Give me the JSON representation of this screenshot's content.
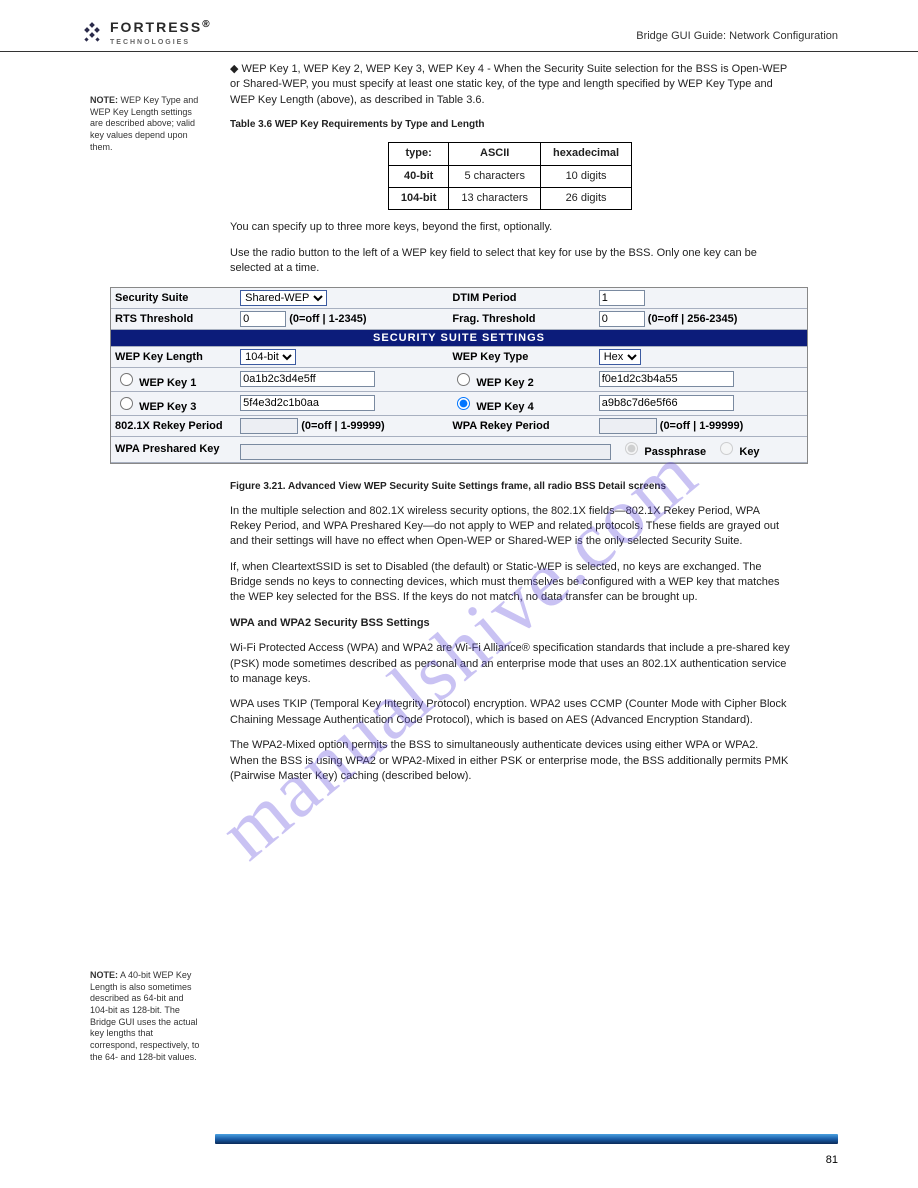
{
  "logo": {
    "main": "FORTRESS",
    "sub": "TECHNOLOGIES",
    "reg": "®"
  },
  "hdr_right": "Bridge GUI Guide: Network Configuration",
  "note1": {
    "title": "NOTE:",
    "body": "WEP Key Type and WEP Key Length settings are described above; valid key values depend upon them."
  },
  "note2": {
    "title": "NOTE:",
    "body": "A 40-bit WEP Key Length is also sometimes described as 64-bit and 104-bit as 128-bit. The Bridge GUI uses the actual key lengths that correspond, respectively, to the 64- and 128-bit values."
  },
  "para": {
    "p1_bullet": "◆  WEP Key 1, WEP Key 2, WEP Key 3, WEP Key 4 - When the Security Suite selection for the BSS is Open-WEP or Shared-WEP, you must specify at least one static key, of the type and length specified by WEP Key Type and WEP Key Length (above), as described in Table 3.6.",
    "tbl_caption": "Table 3.6 WEP Key Requirements by Type and Length",
    "p2": "You can specify up to three more keys, beyond the first, optionally.",
    "p3": "Use the radio button to the left of a WEP key field to select that key for use by the BSS. Only one key can be selected at a time.",
    "fig_caption": "Figure 3.21. Advanced View WEP Security Suite Settings frame, all radio BSS Detail screens",
    "p4": "In the multiple selection and 802.1X wireless security options, the 802.1X fields—802.1X Rekey Period, WPA Rekey Period, and WPA Preshared Key—do not apply to WEP and related protocols. These fields are grayed out and their settings will have no effect when Open-WEP or Shared-WEP is the only selected Security Suite.",
    "p5": "If, when CleartextSSID is set to Disabled (the default) or Static-WEP is selected, no keys are exchanged. The Bridge sends no keys to connecting devices, which must themselves be configured with a WEP key that matches the WEP key selected for the BSS. If the keys do not match, no data transfer can be brought up.",
    "heading": "WPA and WPA2 Security BSS Settings",
    "p6": "Wi-Fi Protected Access (WPA) and WPA2 are Wi-Fi Alliance® specification standards that include a pre-shared key (PSK) mode sometimes described as personal and an enterprise mode that uses an 802.1X authentication service to manage keys.",
    "p7": "WPA uses TKIP (Temporal Key Integrity Protocol) encryption. WPA2 uses CCMP (Counter Mode with Cipher Block Chaining Message Authentication Code Protocol), which is based on AES (Advanced Encryption Standard).",
    "p8": "The WPA2-Mixed option permits the BSS to simultaneously authenticate devices using either WPA or WPA2. When the BSS is using WPA2 or WPA2-Mixed in either PSK or enterprise mode, the BSS additionally permits PMK (Pairwise Master Key) caching (described below)."
  },
  "key_table": {
    "headers": [
      "type:",
      "ASCII",
      "hexadecimal"
    ],
    "rows": [
      {
        "len": "40-bit",
        "ascii": "5 characters",
        "hex": "10 digits"
      },
      {
        "len": "104-bit",
        "ascii": "13 characters",
        "hex": "26 digits"
      }
    ]
  },
  "form": {
    "security_suite": {
      "label": "Security Suite",
      "value": "Shared-WEP"
    },
    "dtim": {
      "label": "DTIM Period",
      "value": "1"
    },
    "rts": {
      "label": "RTS Threshold",
      "value": "0",
      "hint": "(0=off | 1-2345)"
    },
    "frag": {
      "label": "Frag. Threshold",
      "value": "0",
      "hint": "(0=off | 256-2345)"
    },
    "section_title": "SECURITY SUITE SETTINGS",
    "wep_len": {
      "label": "WEP Key Length",
      "value": "104-bit"
    },
    "wep_type": {
      "label": "WEP Key Type",
      "value": "Hex"
    },
    "k1": {
      "label": "WEP Key 1",
      "value": "0a1b2c3d4e5ff"
    },
    "k2": {
      "label": "WEP Key 2",
      "value": "f0e1d2c3b4a55"
    },
    "k3": {
      "label": "WEP Key 3",
      "value": "5f4e3d2c1b0aa"
    },
    "k4": {
      "label": "WEP Key 4",
      "value": "a9b8c7d6e5f66"
    },
    "rekey8021x": {
      "label": "802.1X Rekey Period",
      "hint": "(0=off | 1-99999)"
    },
    "rekeywpa": {
      "label": "WPA Rekey Period",
      "hint": "(0=off | 1-99999)"
    },
    "psk": {
      "label": "WPA Preshared Key",
      "opt1": "Passphrase",
      "opt2": "Key"
    }
  },
  "page_number": "81",
  "watermark": "manualshive.com"
}
